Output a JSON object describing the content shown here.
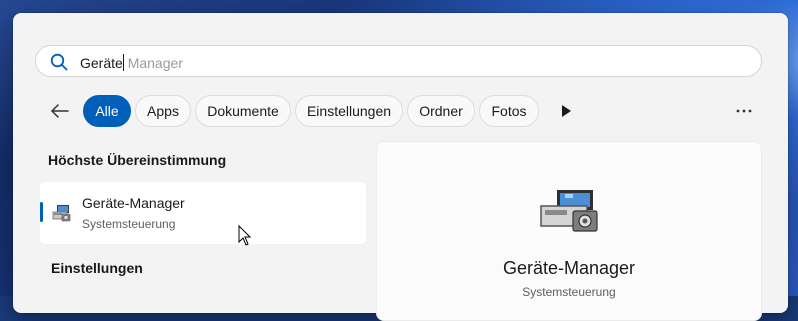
{
  "search": {
    "typed": "Geräte",
    "suggestion": " Manager"
  },
  "filters": {
    "back_icon": "arrow-left-icon",
    "chips": [
      "Alle",
      "Apps",
      "Dokumente",
      "Einstellungen",
      "Ordner",
      "Fotos"
    ],
    "active": "Alle",
    "play_icon": "play-icon",
    "more_icon": "more-horizontal-icon"
  },
  "best_match": {
    "section_title": "Höchste Übereinstimmung",
    "name": "Geräte-Manager",
    "subtitle": "Systemsteuerung",
    "icon": "device-manager-icon"
  },
  "settings_section": {
    "title": "Einstellungen"
  },
  "preview": {
    "name": "Geräte-Manager",
    "subtitle": "Systemsteuerung",
    "icon": "device-manager-icon"
  },
  "colors": {
    "accent": "#005fb8",
    "panel_bg": "#f3f3f3"
  }
}
